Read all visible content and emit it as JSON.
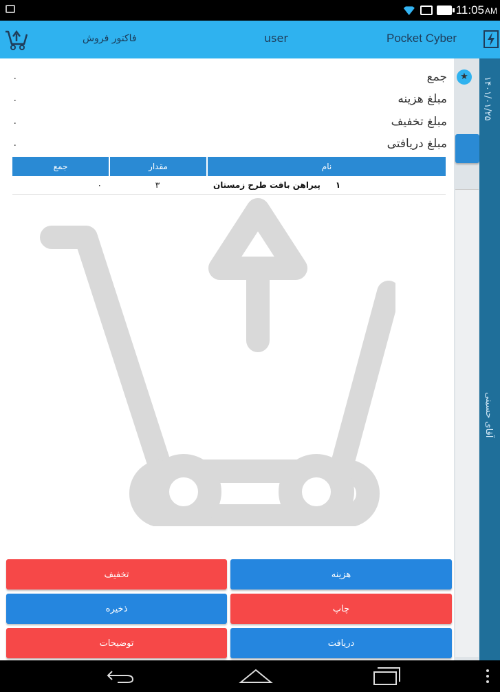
{
  "statusbar": {
    "time": "11:05",
    "ampm": "AM"
  },
  "appbar": {
    "title_right": "Pocket Cyber",
    "title_center": "user",
    "title_left": "فاکتور فروش"
  },
  "side": {
    "date": "۱۴۰۱/۰۱/۲۵",
    "label": "آقای حسینی"
  },
  "summary": [
    {
      "label": "جمع",
      "value": "۰"
    },
    {
      "label": "مبلغ هزینه",
      "value": "۰"
    },
    {
      "label": "مبلغ تخفیف",
      "value": "۰"
    },
    {
      "label": "مبلغ دریافتی",
      "value": "۰"
    }
  ],
  "table": {
    "headers": {
      "name": "نام",
      "qty": "مقدار",
      "sum": "جمع"
    },
    "rows": [
      {
        "num": "۱",
        "name": "پیراهن بافت طرح زمستان",
        "qty": "۳",
        "sum": "۰"
      }
    ]
  },
  "buttons": {
    "expense": "هزینه",
    "discount": "تخفیف",
    "print": "چاپ",
    "save": "ذخیره",
    "receive": "دریافت",
    "notes": "توضیحات"
  },
  "colors": {
    "appbar": "#2fb2ef",
    "header": "#2a8ad4",
    "red": "#f64848",
    "blue": "#2586df"
  }
}
